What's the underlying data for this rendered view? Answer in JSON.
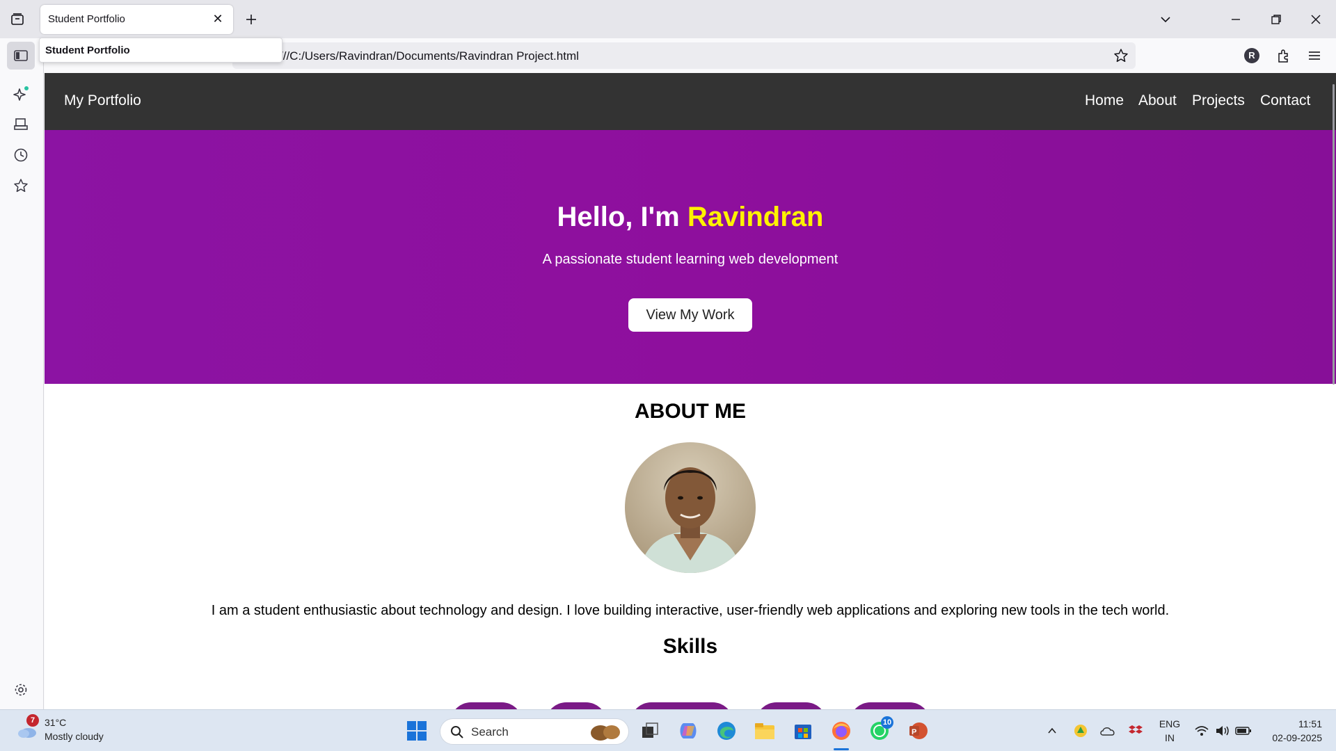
{
  "browser": {
    "tab_title": "Student Portfolio",
    "tooltip": "Student Portfolio",
    "url": "///C:/Users/Ravindran/Documents/Ravindran Project.html",
    "profile_initial": "R"
  },
  "site": {
    "logo": "My Portfolio",
    "nav": [
      "Home",
      "About",
      "Projects",
      "Contact"
    ],
    "hero": {
      "greeting": "Hello, I'm ",
      "name": "Ravindran",
      "subtitle": "A passionate student learning web development",
      "button": "View My Work"
    },
    "about": {
      "title": "ABOUT ME",
      "text": "I am a student enthusiastic about technology and design. I love building interactive, user-friendly web applications and exploring new tools in the tech world."
    },
    "skills_title": "Skills"
  },
  "taskbar": {
    "weather": {
      "temp": "31°C",
      "condition": "Mostly cloudy",
      "badge": "7"
    },
    "search_label": "Search",
    "whatsapp_badge": "10",
    "lang": {
      "line1": "ENG",
      "line2": "IN"
    },
    "time": "11:51",
    "date": "02-09-2025"
  },
  "colors": {
    "hero_bg": "#8e0f9d",
    "accent_name": "#fff200",
    "nav_bg": "#333333"
  }
}
